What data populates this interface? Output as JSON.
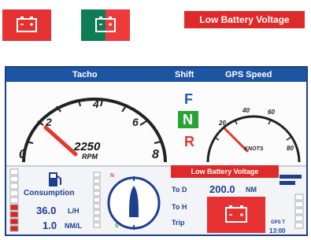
{
  "legend": {
    "warning_banner": "Low Battery Voltage",
    "icons": [
      "battery-icon",
      "battery-icon"
    ]
  },
  "dashboard": {
    "header": {
      "tacho": "Tacho",
      "shift": "Shift",
      "gps_speed": "GPS Speed"
    },
    "tacho": {
      "rpm_value": "2250",
      "rpm_unit": "RPM",
      "ticks": [
        "0",
        "2",
        "4",
        "6",
        "8"
      ]
    },
    "shift": {
      "forward": "F",
      "neutral": "N",
      "reverse": "R",
      "selected": "N"
    },
    "gps": {
      "ticks": [
        "20",
        "40",
        "60",
        "80"
      ],
      "unit": "KNOTS"
    },
    "consumption": {
      "label": "Consumption",
      "rate_value": "36.0",
      "rate_unit": "L/H",
      "economy_value": "1.0",
      "economy_unit": "NM/L"
    },
    "compass": {
      "n": "N",
      "s": "S"
    },
    "nav": {
      "to_d_label": "To D",
      "to_h_label": "To H",
      "trip_label": "Trip",
      "distance_value": "200.0",
      "distance_unit": "NM",
      "gps_label": "GPS T",
      "gps_time": "13:00"
    },
    "alert_banner": "Low Battery Voltage",
    "colors": {
      "header": "#1e55a3",
      "alert": "#df2a2a",
      "neutral_gear": "#2aa335",
      "forward_gear": "#1e5fb0",
      "reverse_gear": "#e03a2e"
    }
  }
}
